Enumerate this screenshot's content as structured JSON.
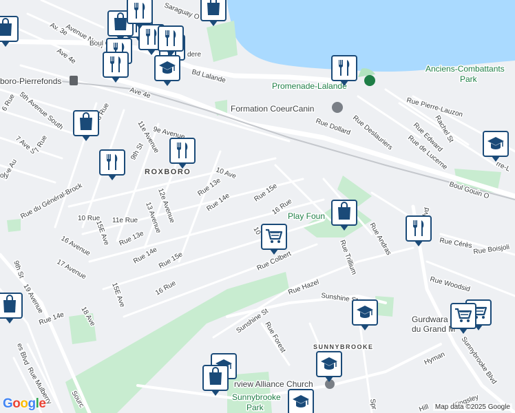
{
  "colors": {
    "water": "#aadaff",
    "park": "#c8ecd0",
    "park_dark": "#b2e3bf",
    "road_major": "#ffffff",
    "background": "#eef0f3",
    "marker": "#1a4a78"
  },
  "water_labels": [],
  "area_labels": [
    {
      "text": "ROXBORO"
    },
    {
      "text": "SUNNYBROOKE"
    }
  ],
  "place_labels": [
    {
      "text": "Anciens-Combattants",
      "kind": "park"
    },
    {
      "text": "Park",
      "kind": "park"
    },
    {
      "text": "Promenade-Lalande",
      "kind": "park"
    },
    {
      "text": "Formation CoeurCanin",
      "kind": "poi"
    },
    {
      "text": "Play Foun",
      "kind": "park"
    },
    {
      "text": "Gurdwara",
      "kind": "poi"
    },
    {
      "text": "du Grand M",
      "kind": "poi"
    },
    {
      "text": "rview Alliance Church",
      "kind": "poi"
    },
    {
      "text": "Sunnybrooke",
      "kind": "park"
    },
    {
      "text": "Park",
      "kind": "park"
    },
    {
      "text": "boro-Pierrefonds",
      "kind": "transit"
    }
  ],
  "street_labels": [
    "Avenue North",
    "Av. 3e",
    "Ave 4e",
    "Boul Gouin O",
    "Bd Lalande",
    "dere",
    "Saraguay O",
    "Ave 4e",
    "5th Avenue South",
    "6 Rue",
    "7 Ave S",
    "7 Rue",
    "8 Rue",
    "9e Avenue",
    "11e Avenue",
    "9th St",
    "10 Ave",
    "Rue 13e",
    "Rue 15e",
    "16 Rue",
    "Rue 14e",
    "12e Avenue",
    "13 Avenue",
    "Rue du Général-Brock",
    "10 Rue",
    "11e Rue",
    "15E Ave",
    "Rue 13e",
    "16 Avenue",
    "17 Avenue",
    "Rue 14e",
    "Rue 15e",
    "15E Ave",
    "16 Rue",
    "9th St",
    "19 Avenue",
    "Rue 14e",
    "18 Ave",
    "Rue Dollard",
    "Rue Deslauriers",
    "Rue Pierre-Lauzon",
    "Rue Edward",
    "Rachel St",
    "Rue de Lucerne",
    "Boul Gouin O",
    "Rue Andras",
    "Rue Cérès",
    "Rue Boisjoli",
    "Rue Woodsid",
    "Rue Colbert",
    "Rue Trillium",
    "Rue Hazel",
    "Sunshine St",
    "Sunshine St",
    "Rue Forest",
    "Hyman",
    "Sunnybrooke Blvd",
    "Rue Mulberry",
    "Sourc",
    "Spr",
    "Kingsley",
    "Hill",
    "10",
    "ooke Blvd",
    "rre-L",
    "Rue Au",
    "oly",
    "es Blvd"
  ],
  "pois": [
    {
      "icon": "restaurant-icon"
    },
    {
      "icon": "shopping-bag-icon"
    },
    {
      "icon": "restaurant-icon"
    },
    {
      "icon": "restaurant-icon"
    },
    {
      "icon": "restaurant-icon"
    },
    {
      "icon": "restaurant-icon"
    },
    {
      "icon": "restaurant-icon"
    },
    {
      "icon": "school-icon"
    },
    {
      "icon": "shopping-bag-icon"
    },
    {
      "icon": "shopping-bag-icon"
    },
    {
      "icon": "restaurant-icon"
    },
    {
      "icon": "restaurant-icon"
    },
    {
      "icon": "restaurant-icon"
    },
    {
      "icon": "restaurant-icon"
    },
    {
      "icon": "shopping-cart-icon"
    },
    {
      "icon": "shopping-bag-icon"
    },
    {
      "icon": "restaurant-icon"
    },
    {
      "icon": "school-icon"
    },
    {
      "icon": "shopping-bag-icon"
    },
    {
      "icon": "school-icon"
    },
    {
      "icon": "shopping-cart-icon"
    },
    {
      "icon": "shopping-cart-icon"
    },
    {
      "icon": "school-icon"
    },
    {
      "icon": "school-icon"
    },
    {
      "icon": "shopping-bag-icon"
    },
    {
      "icon": "school-icon"
    }
  ],
  "logo_text": "Google",
  "attribution": "Map data ©2025 Google"
}
